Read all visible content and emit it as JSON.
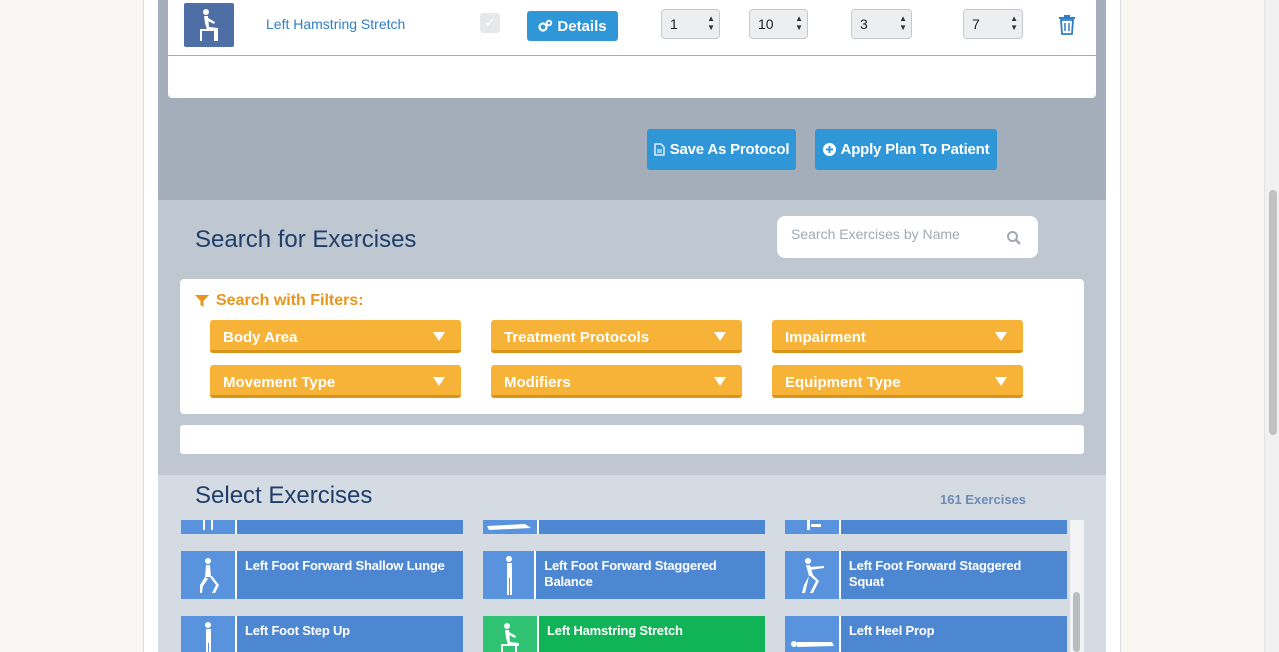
{
  "plan_row": {
    "exercise_name": "Left Hamstring Stretch",
    "details_label": "Details",
    "spinners": [
      "1",
      "10",
      "3",
      "7"
    ]
  },
  "actions": {
    "save_protocol": "Save As Protocol",
    "apply_plan": "Apply Plan To Patient"
  },
  "search": {
    "title": "Search for Exercises",
    "placeholder": "Search Exercises by Name",
    "filters_heading": "Search with Filters:",
    "filters": [
      "Body Area",
      "Treatment Protocols",
      "Impairment",
      "Movement Type",
      "Modifiers",
      "Equipment Type"
    ]
  },
  "select": {
    "title": "Select Exercises",
    "count": "161 Exercises",
    "tiles": [
      {
        "label": ""
      },
      {
        "label": ""
      },
      {
        "label": ""
      },
      {
        "label": "Left Foot Forward Shallow Lunge"
      },
      {
        "label": "Left Foot Forward Staggered Balance"
      },
      {
        "label": "Left Foot Forward Staggered Squat"
      },
      {
        "label": "Left Foot Step Up"
      },
      {
        "label": "Left Hamstring Stretch",
        "selected": true
      },
      {
        "label": "Left Heel Prop"
      }
    ]
  },
  "colors": {
    "accent_blue": "#2f96d8",
    "filter_orange": "#f7b337",
    "tile_blue": "#4e87d1",
    "tile_green": "#10b356",
    "title_navy": "#1f3e6a"
  }
}
